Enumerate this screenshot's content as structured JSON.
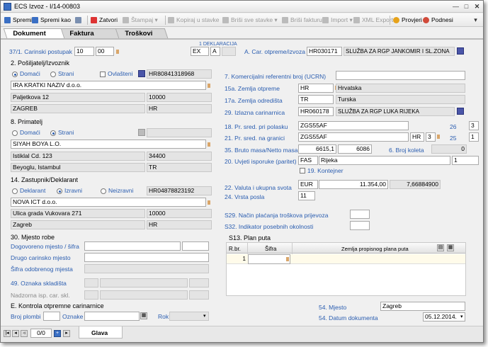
{
  "window": {
    "title": "ECS Izvoz - I/14-00803"
  },
  "toolbar": {
    "spremi": "Spremi",
    "spremi_kao": "Spremi kao",
    "zatvori": "Zatvori",
    "stampaj": "Štampaj",
    "kopiraj": "Kopiraj u stavke",
    "brisi_stavke": "Briši sve stavke",
    "brisi_fakturu": "Briši fakturu",
    "import": "Import",
    "xml_export": "XML Export",
    "provjeri": "Provjeri",
    "podnesi": "Podnesi"
  },
  "tabs": [
    "Dokument",
    "Faktura",
    "Troškovi"
  ],
  "deklaracija": {
    "header": "1 DEKLARACIJA",
    "v1": "EX",
    "v2": "A"
  },
  "carinski_postupak": {
    "label": "37/1. Carinski postupak",
    "v1": "10",
    "v2": "00"
  },
  "car_otpreme": {
    "label": "A. Car. otpreme/izvoza",
    "code": "HR030171",
    "name": "SLUŽBA ZA RGP JANKOMIR I SL.ZONA"
  },
  "posiljatelj": {
    "title": "2. Pošiljatelj/Izvoznik",
    "opt_domaci": "Domaći",
    "opt_strani": "Strani",
    "opt_ovlasteni": "Ovlašteni",
    "oib": "HR80841318968",
    "naziv": "IRA KRATKI NAZIV d.o.o.",
    "adresa": "Paljetkova 12",
    "postanski": "10000",
    "mjesto": "ZAGREB",
    "drzava": "HR"
  },
  "primatelj": {
    "title": "8. Primatelj",
    "opt_domaci": "Domaći",
    "opt_strani": "Strani",
    "naziv": "SIYAH BOYA L.O.",
    "adresa": "Istiklal Cd. 123",
    "postanski": "34400",
    "mjesto": "Beyoglu, Istambul",
    "drzava": "TR"
  },
  "zastupnik": {
    "title": "14. Zastupnik/Deklarant",
    "opt_deklarant": "Deklarant",
    "opt_izravni": "Izravni",
    "opt_neizravni": "Neizravni",
    "oib": "HR04878823192",
    "naziv": "NOVA ICT d.o.o.",
    "adresa": "Ulica grada Vukovara 271",
    "postanski": "10000",
    "mjesto": "Zagreb",
    "drzava": "HR"
  },
  "mjesto_robe": {
    "title": "30. Mjesto robe",
    "dogovoreno": "Dogovoreno mjesto / šifra",
    "drugo": "Drugo carinsko mjesto",
    "sifra_odobrenog": "Šifra odobrenog mjesta"
  },
  "oznaka_skladista": "49. Oznaka skladišta",
  "nadzorna": "Nadzorna isp. car. skl.",
  "kontrola": {
    "title": "E. Kontrola otpremne carinarnice",
    "broj_plombi": "Broj plombi",
    "oznake": "Oznake",
    "rok": "Rok"
  },
  "ucrn": {
    "label": "7. Komercijalni referentni broj (UCRN)"
  },
  "zemlja_otpreme": {
    "label": "15a. Zemlja otpreme",
    "code": "HR",
    "name": "Hrvatska"
  },
  "zemlja_odredista": {
    "label": "17a. Zemlja odredišta",
    "code": "TR",
    "name": "Turska"
  },
  "izlazna": {
    "label": "29. Izlazna carinarnica",
    "code": "HR060178",
    "name": "SLUŽBA ZA RGP LUKA RIJEKA"
  },
  "pr_polasku": {
    "label": "18. Pr. sred. pri polasku",
    "value": "ZGS55AF",
    "f26_label": "26",
    "f26": "3"
  },
  "pr_granici": {
    "label": "21. Pr. sred. na granici",
    "value": "ZGS55AF",
    "drz": "HR",
    "n": "3",
    "f25_label": "25",
    "f25": "1"
  },
  "masa": {
    "label": "35. Bruto masa/Netto masa",
    "bruto": "6615,1",
    "netto": "6086",
    "koleta_label": "6. Broj koleta",
    "koleta": "0"
  },
  "isporuka": {
    "label": "20. Uvjeti isporuke (paritet)",
    "code": "FAS",
    "mjesto": "Rijeka",
    "n": "1",
    "kontejner": "19. Kontejner"
  },
  "valuta": {
    "label": "22. Valuta i ukupna svota",
    "code": "EUR",
    "iznos": "11.354,00",
    "tecaj": "7,66884900"
  },
  "vrsta_posla": {
    "label": "24. Vrsta posla",
    "value": "11"
  },
  "s29": "S29. Način plaćanja troškova prijevoza",
  "s32": "S32. Indikator posebnih okolnosti",
  "plan_puta": {
    "title": "S13. Plan puta",
    "col_rbr": "R.br.",
    "col_sifra": "Šifra",
    "col_zemlja": "Zemlja propisnog plana puta",
    "row_rbr": "1"
  },
  "mjesto": {
    "label": "54. Mjesto",
    "value": "Zagreb"
  },
  "datum": {
    "label": "54. Datum dokumenta",
    "value": "05.12.2014."
  },
  "bottom": {
    "counter": "0/0",
    "tab": "Glava"
  }
}
